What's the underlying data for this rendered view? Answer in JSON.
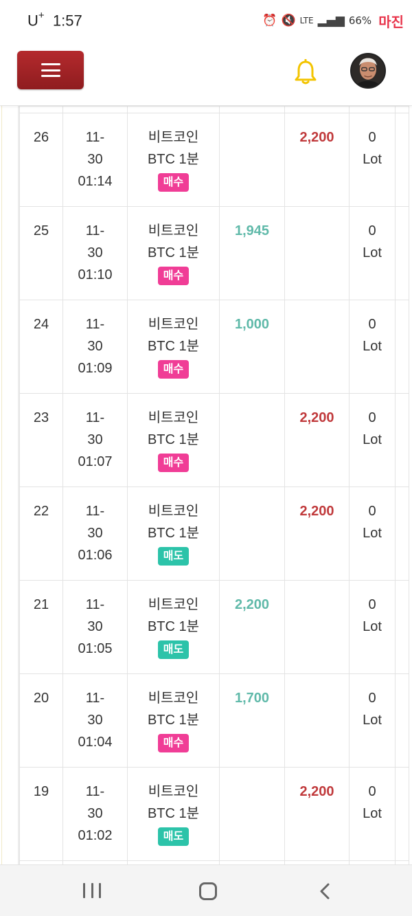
{
  "status_bar": {
    "carrier": "U",
    "carrier_plus": "+",
    "time": "1:57",
    "network": "LTE",
    "battery": "66%",
    "watermark": "마진"
  },
  "colors": {
    "menu_button": "#a12326",
    "bell": "#f3c400",
    "profit": "#5fb9a9",
    "loss": "#c0393b",
    "buy_tag": "#f03d96",
    "sell_tag": "#2cc3a9"
  },
  "header": {
    "menu_icon": "hamburger-icon",
    "bell_icon": "bell-icon",
    "avatar_icon": "user-avatar"
  },
  "trades": [
    {
      "no": "26",
      "date": "11-",
      "day": "30",
      "time": "01:14",
      "name": "비트코인",
      "product": "BTC 1분",
      "side": "매수",
      "side_type": "buy",
      "profit": "",
      "loss": "2,200",
      "lot": "0",
      "lot_unit": "Lot"
    },
    {
      "no": "25",
      "date": "11-",
      "day": "30",
      "time": "01:10",
      "name": "비트코인",
      "product": "BTC 1분",
      "side": "매수",
      "side_type": "buy",
      "profit": "1,945",
      "loss": "",
      "lot": "0",
      "lot_unit": "Lot"
    },
    {
      "no": "24",
      "date": "11-",
      "day": "30",
      "time": "01:09",
      "name": "비트코인",
      "product": "BTC 1분",
      "side": "매수",
      "side_type": "buy",
      "profit": "1,000",
      "loss": "",
      "lot": "0",
      "lot_unit": "Lot"
    },
    {
      "no": "23",
      "date": "11-",
      "day": "30",
      "time": "01:07",
      "name": "비트코인",
      "product": "BTC 1분",
      "side": "매수",
      "side_type": "buy",
      "profit": "",
      "loss": "2,200",
      "lot": "0",
      "lot_unit": "Lot"
    },
    {
      "no": "22",
      "date": "11-",
      "day": "30",
      "time": "01:06",
      "name": "비트코인",
      "product": "BTC 1분",
      "side": "매도",
      "side_type": "sell",
      "profit": "",
      "loss": "2,200",
      "lot": "0",
      "lot_unit": "Lot"
    },
    {
      "no": "21",
      "date": "11-",
      "day": "30",
      "time": "01:05",
      "name": "비트코인",
      "product": "BTC 1분",
      "side": "매도",
      "side_type": "sell",
      "profit": "2,200",
      "loss": "",
      "lot": "0",
      "lot_unit": "Lot"
    },
    {
      "no": "20",
      "date": "11-",
      "day": "30",
      "time": "01:04",
      "name": "비트코인",
      "product": "BTC 1분",
      "side": "매수",
      "side_type": "buy",
      "profit": "1,700",
      "loss": "",
      "lot": "0",
      "lot_unit": "Lot"
    },
    {
      "no": "19",
      "date": "11-",
      "day": "30",
      "time": "01:02",
      "name": "비트코인",
      "product": "BTC 1분",
      "side": "매도",
      "side_type": "sell",
      "profit": "",
      "loss": "2,200",
      "lot": "0",
      "lot_unit": "Lot"
    }
  ],
  "nav_bar": {
    "recent_icon": "recent-apps-icon",
    "home_icon": "home-icon",
    "back_icon": "back-icon"
  }
}
